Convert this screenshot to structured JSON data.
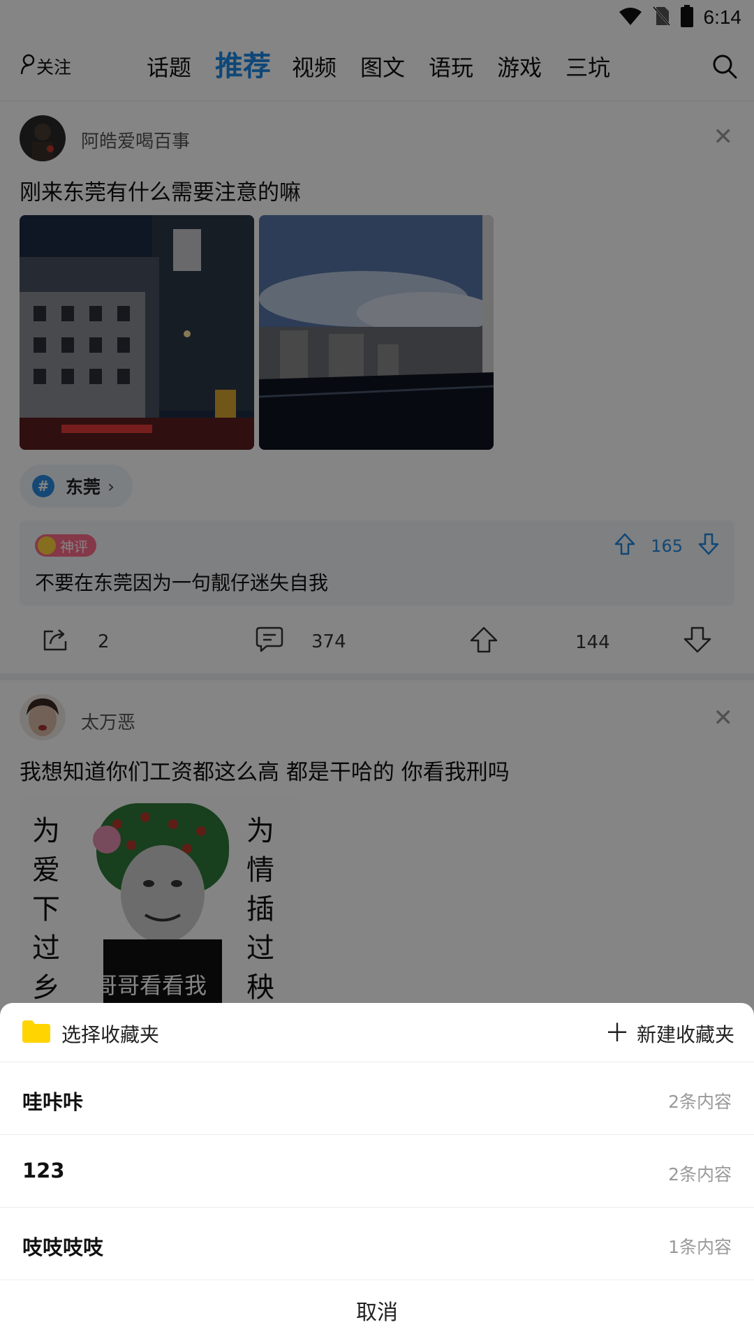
{
  "status_bar": {
    "time": "6:14",
    "icons": [
      "wifi-icon",
      "no-sim-icon",
      "battery-icon"
    ]
  },
  "nav": {
    "follow_label": "关注",
    "tabs": [
      "话题",
      "推荐",
      "视频",
      "图文",
      "语玩",
      "游戏",
      "三坑"
    ],
    "active_tab": "推荐",
    "search_icon": "search-icon"
  },
  "post1": {
    "username": "阿皓爱喝百事",
    "text": "刚来东莞有什么需要注意的嘛",
    "topic": "东莞",
    "god_comment": {
      "badge": "神评",
      "text": "不要在东莞因为一句靓仔迷失自我",
      "votes": "165"
    },
    "actions": {
      "share": "2",
      "comment": "374",
      "like": "144"
    }
  },
  "post2": {
    "username": "太万恶",
    "text": "我想知道你们工资都这么高 都是干哈的 你看我刑吗",
    "image_text": {
      "left": [
        "为",
        "爱",
        "下",
        "过",
        "乡"
      ],
      "right": [
        "为",
        "情",
        "插",
        "过",
        "秧"
      ],
      "caption": "哥哥看看我"
    }
  },
  "sheet": {
    "title": "选择收藏夹",
    "new_folder": "新建收藏夹",
    "folders": [
      {
        "name": "哇咔咔",
        "count": "2条内容"
      },
      {
        "name": "123",
        "count": "2条内容"
      },
      {
        "name": "吱吱吱吱",
        "count": "1条内容"
      }
    ],
    "cancel": "取消"
  },
  "colors": {
    "accent": "#1e88e5",
    "folder": "#ffd400",
    "badge": "#ff6b8b"
  }
}
